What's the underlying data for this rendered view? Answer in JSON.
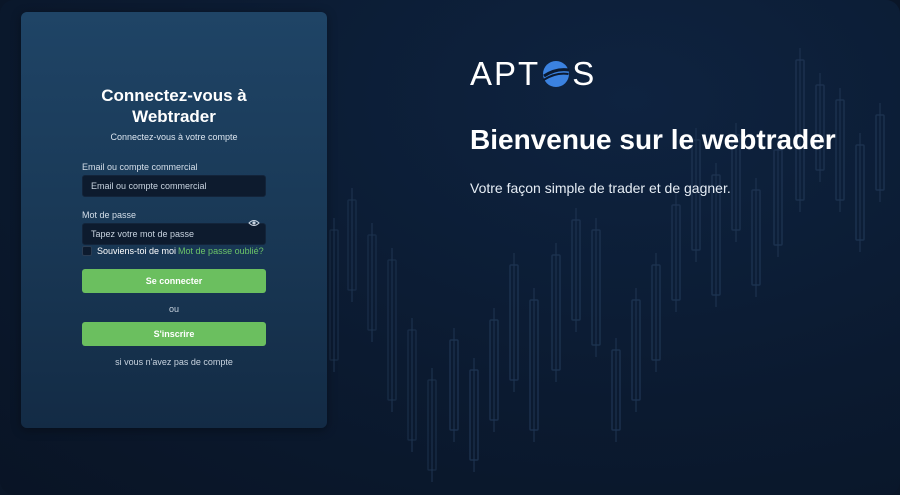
{
  "login": {
    "title_line1": "Connectez-vous à",
    "title_line2": "Webtrader",
    "subtitle": "Connectez-vous à votre compte",
    "email_label": "Email ou compte commercial",
    "email_placeholder": "Email ou compte commercial",
    "password_label": "Mot de passe",
    "password_placeholder": "Tapez votre mot de passe",
    "remember_label": "Souviens-toi de moi",
    "forgot_link": "Mot de passe oublié?",
    "login_button": "Se connecter",
    "or_text": "ou",
    "register_button": "S'inscrire",
    "no_account_text": "si vous n'avez pas de compte"
  },
  "hero": {
    "brand_left": "APT",
    "brand_right": "S",
    "welcome": "Bienvenue sur le webtrader",
    "tagline": "Votre façon simple de trader et de gagner."
  },
  "colors": {
    "accent_green": "#6bbf5f",
    "link_green": "#6cc468",
    "logo_blue": "#3b82e0"
  }
}
